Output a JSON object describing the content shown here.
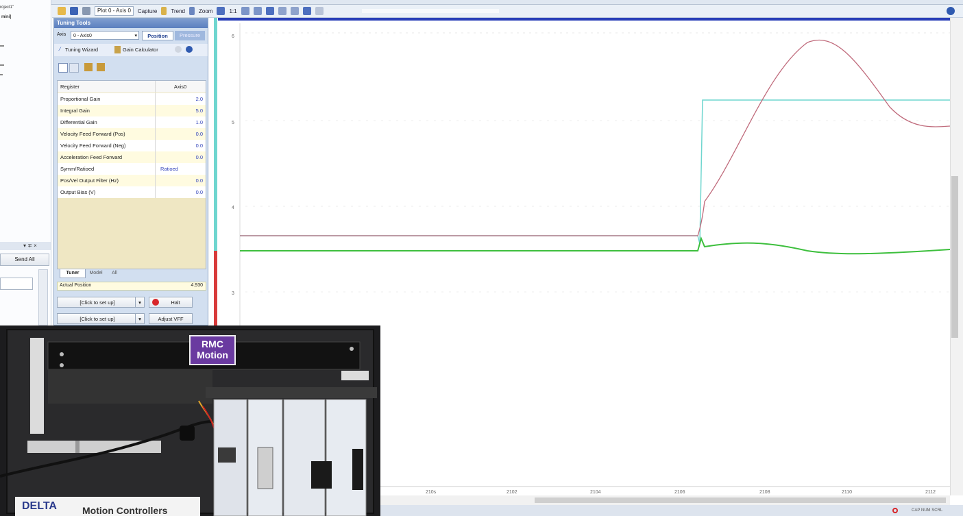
{
  "toolbar": {
    "plot_select": "Plot 0 - Axis 0",
    "capture_label": "Capture",
    "trend_label": "Trend",
    "zoom_label": "Zoom",
    "zoom_ratio": "1:1"
  },
  "explorer": {
    "lines": [
      "roject1\"",
      "mini]"
    ],
    "send_all_label": "Send All"
  },
  "tuning": {
    "title": "Tuning Tools",
    "axis_label": "Axis",
    "axis_value": "0 - Axis0",
    "tab_position": "Position",
    "tab_pressure": "Pressure",
    "wizard_label": "Tuning Wizard",
    "gain_calc_label": "Gain Calculator",
    "header_register": "Register",
    "header_axis": "Axis0",
    "rows": [
      {
        "name": "Proportional Gain",
        "value": "2.0"
      },
      {
        "name": "Integral Gain",
        "value": "5.0"
      },
      {
        "name": "Differential Gain",
        "value": "1.0"
      },
      {
        "name": "Velocity Feed Forward (Pos)",
        "value": "0.0"
      },
      {
        "name": "Velocity Feed Forward (Neg)",
        "value": "0.0"
      },
      {
        "name": "Acceleration Feed Forward",
        "value": "0.0"
      },
      {
        "name": "Symm/Ratioed",
        "value": "Ratioed"
      },
      {
        "name": "Pos/Vel Output Filter (Hz)",
        "value": "0.0"
      },
      {
        "name": "Output Bias (V)",
        "value": "0.0"
      }
    ],
    "bottom_tabs": [
      "Tuner",
      "Model",
      "All"
    ],
    "actual_position_label": "Actual Position",
    "actual_position_value": "4.930",
    "click_setup_1": "[Click to set up]",
    "click_setup_2": "[Click to set up]",
    "halt_label": "Halt",
    "adjust_label": "Adjust VFF"
  },
  "plot": {
    "y_ticks": [
      "6",
      "5",
      "4",
      "3"
    ],
    "x_ticks": [
      "210s",
      "2102",
      "2104",
      "2106",
      "2108",
      "2110",
      "2112"
    ],
    "colors": {
      "actual": "#c06b7c",
      "target": "#6fd6cf",
      "drive": "#3dbf3d"
    }
  },
  "photo": {
    "brand": "DELTA",
    "tagline": "Motion Controllers",
    "badge_line1": "RMC",
    "badge_line2": "Motion"
  },
  "statusbar": {
    "indicators": "CAP NUM SCRL"
  }
}
